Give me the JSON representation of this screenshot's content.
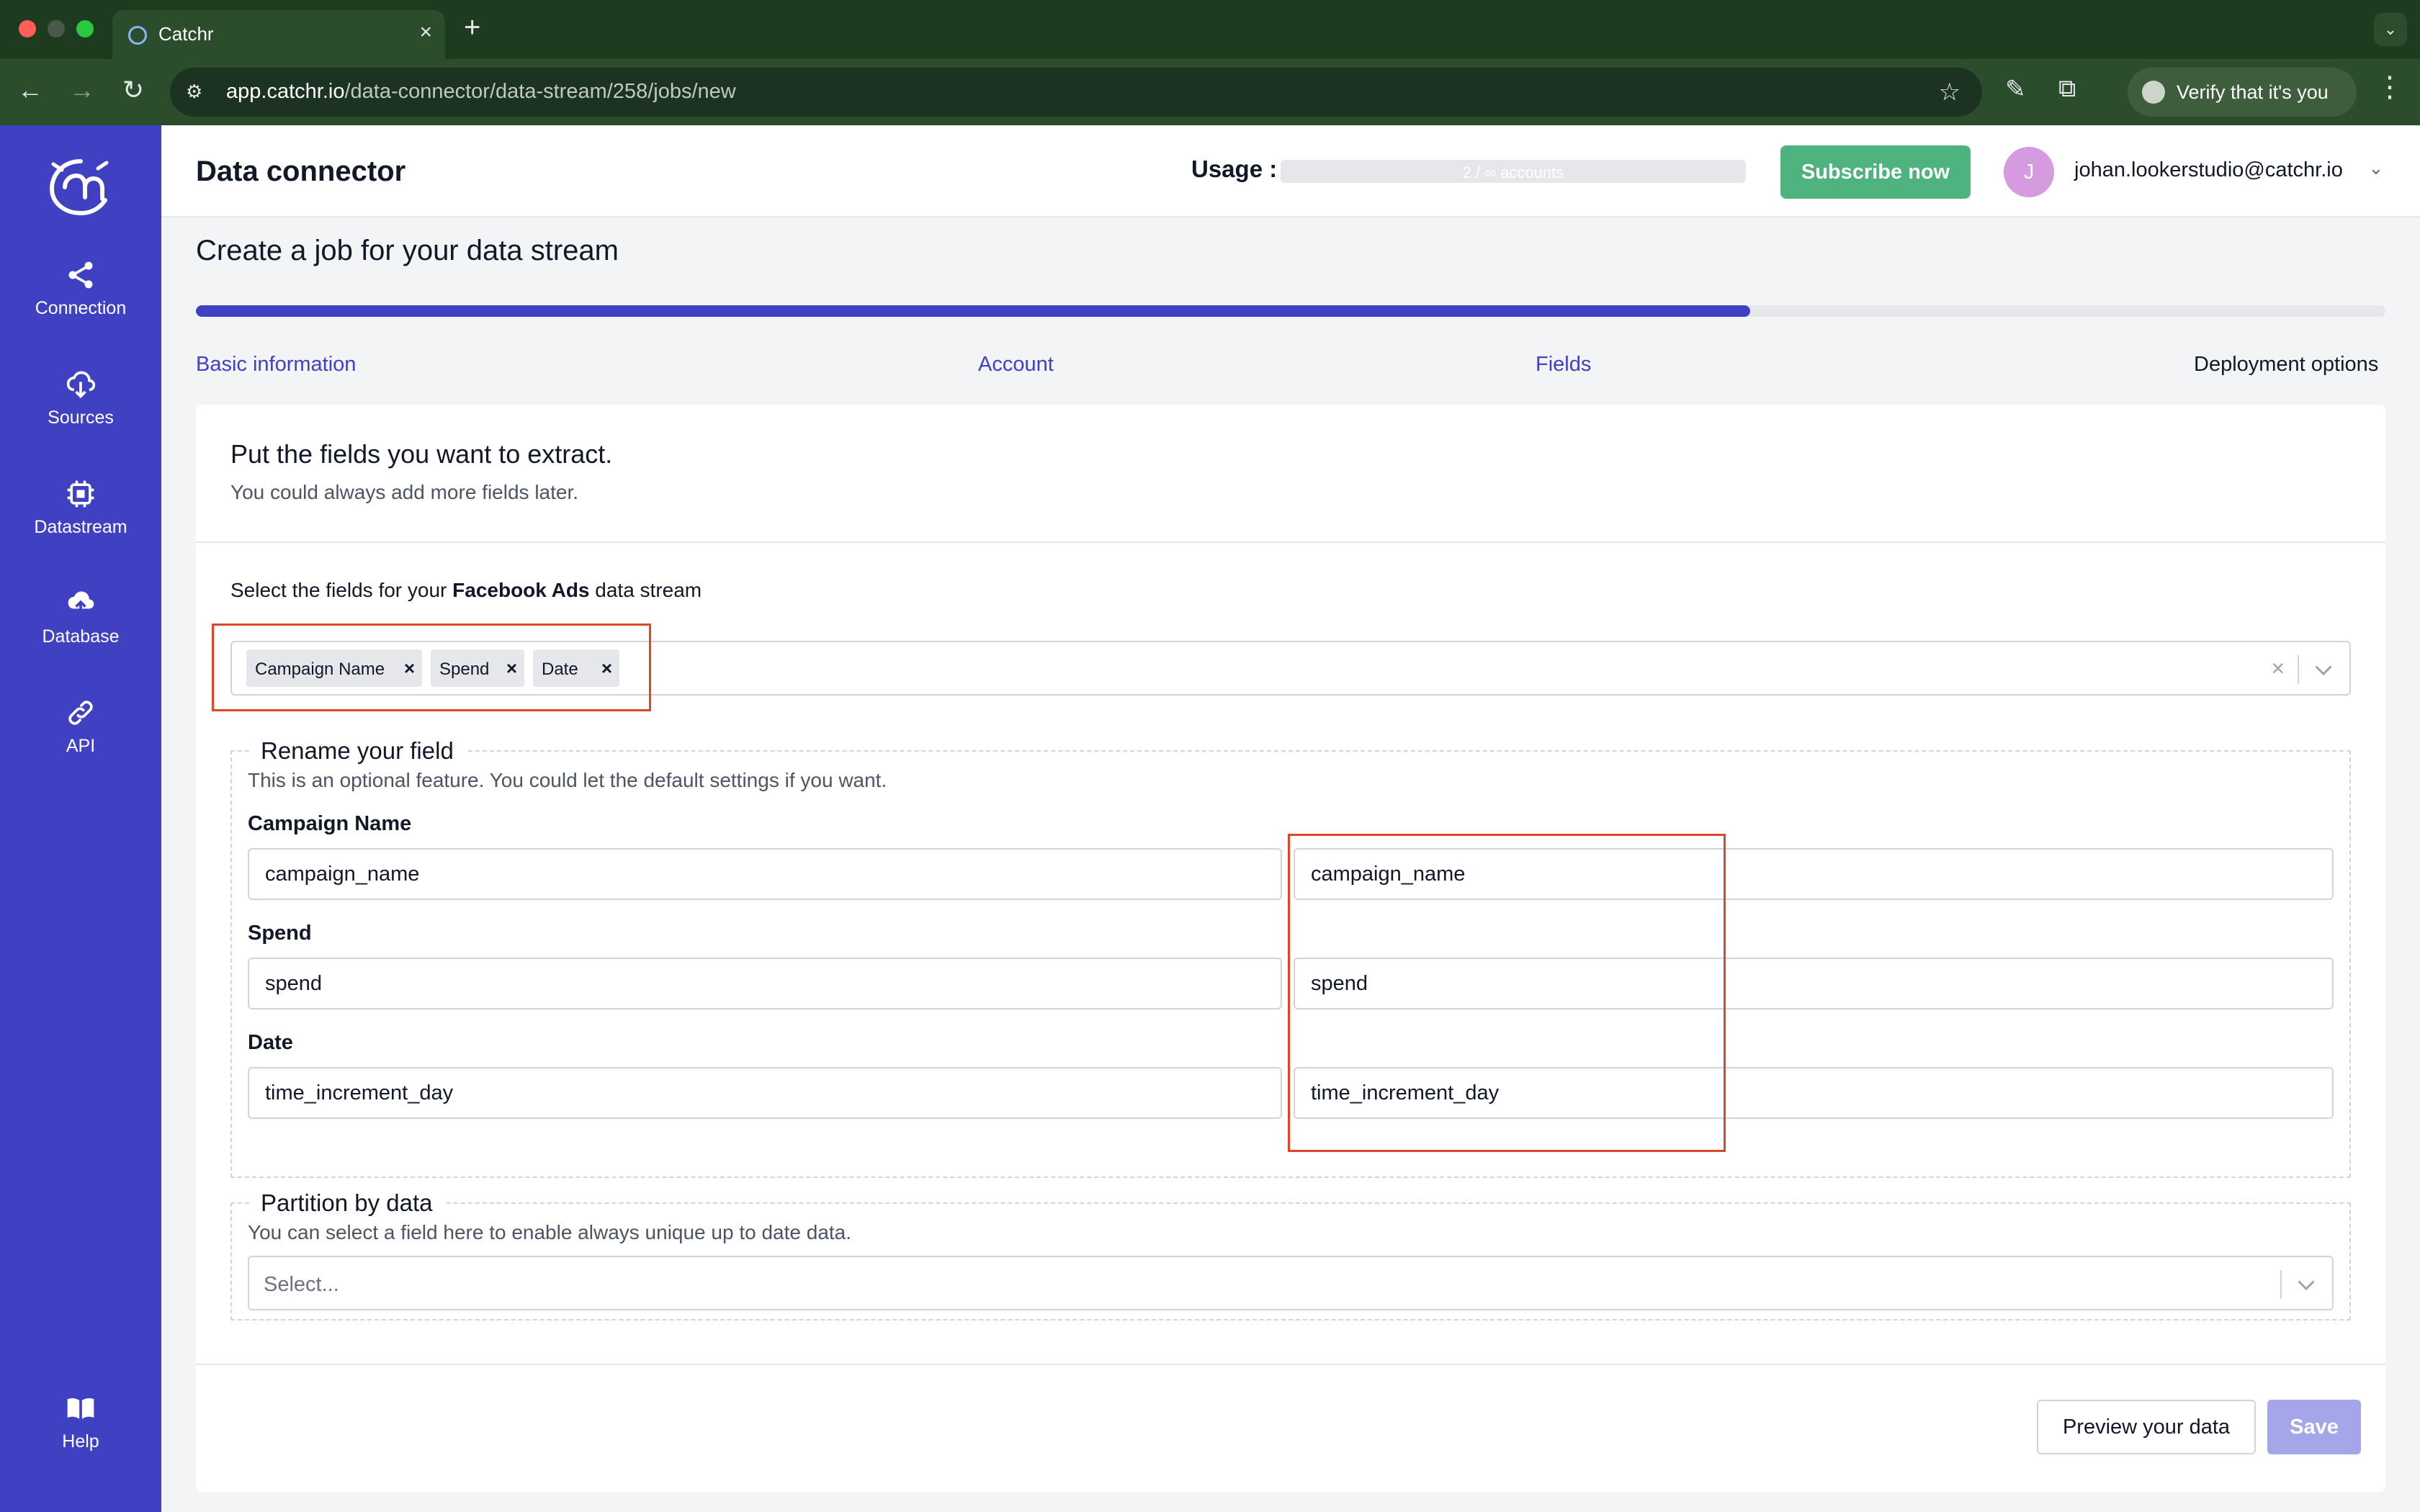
{
  "browser": {
    "tab_title": "Catchr",
    "url_host": "app.catchr.io",
    "url_path": "/data-connector/data-stream/258/jobs/new",
    "verify_label": "Verify that it's you"
  },
  "sidebar": {
    "items": [
      {
        "label": "Connection",
        "icon": "share-icon"
      },
      {
        "label": "Sources",
        "icon": "cloud-download-icon"
      },
      {
        "label": "Datastream",
        "icon": "chip-icon"
      },
      {
        "label": "Database",
        "icon": "cloud-upload-icon"
      },
      {
        "label": "API",
        "icon": "link-icon"
      }
    ],
    "help_label": "Help"
  },
  "header": {
    "title": "Data connector",
    "usage_label": "Usage :",
    "usage_text": "2 / ∞ accounts",
    "subscribe_label": "Subscribe now",
    "avatar_initial": "J",
    "user_email": "johan.lookerstudio@catchr.io"
  },
  "page": {
    "title": "Create a job for your data stream",
    "progress_fraction": 0.71,
    "steps": [
      {
        "label": "Basic information",
        "active": true
      },
      {
        "label": "Account",
        "active": true
      },
      {
        "label": "Fields",
        "active": true
      },
      {
        "label": "Deployment options",
        "active": false
      }
    ]
  },
  "card": {
    "title": "Put the fields you want to extract.",
    "subtitle": "You could always add more fields later.",
    "select_prefix": "Select the fields for your",
    "source_name": "Facebook Ads",
    "select_suffix": "data stream",
    "chips": [
      "Campaign Name",
      "Spend",
      "Date"
    ]
  },
  "rename": {
    "legend": "Rename your field",
    "description": "This is an optional feature. You could let the default settings if you want.",
    "fields": [
      {
        "label": "Campaign Name",
        "source_value": "campaign_name",
        "rename_value": "campaign_name"
      },
      {
        "label": "Spend",
        "source_value": "spend",
        "rename_value": "spend"
      },
      {
        "label": "Date",
        "source_value": "time_increment_day",
        "rename_value": "time_increment_day"
      }
    ]
  },
  "partition": {
    "legend": "Partition by data",
    "description": "You can select a field here to enable always unique up to date data.",
    "placeholder": "Select..."
  },
  "footer": {
    "preview_label": "Preview your data",
    "save_label": "Save"
  },
  "colors": {
    "brand": "#4041c2",
    "subscribe": "#4fb37f",
    "highlight": "#e0452c",
    "save_disabled": "#a5a6ea"
  }
}
